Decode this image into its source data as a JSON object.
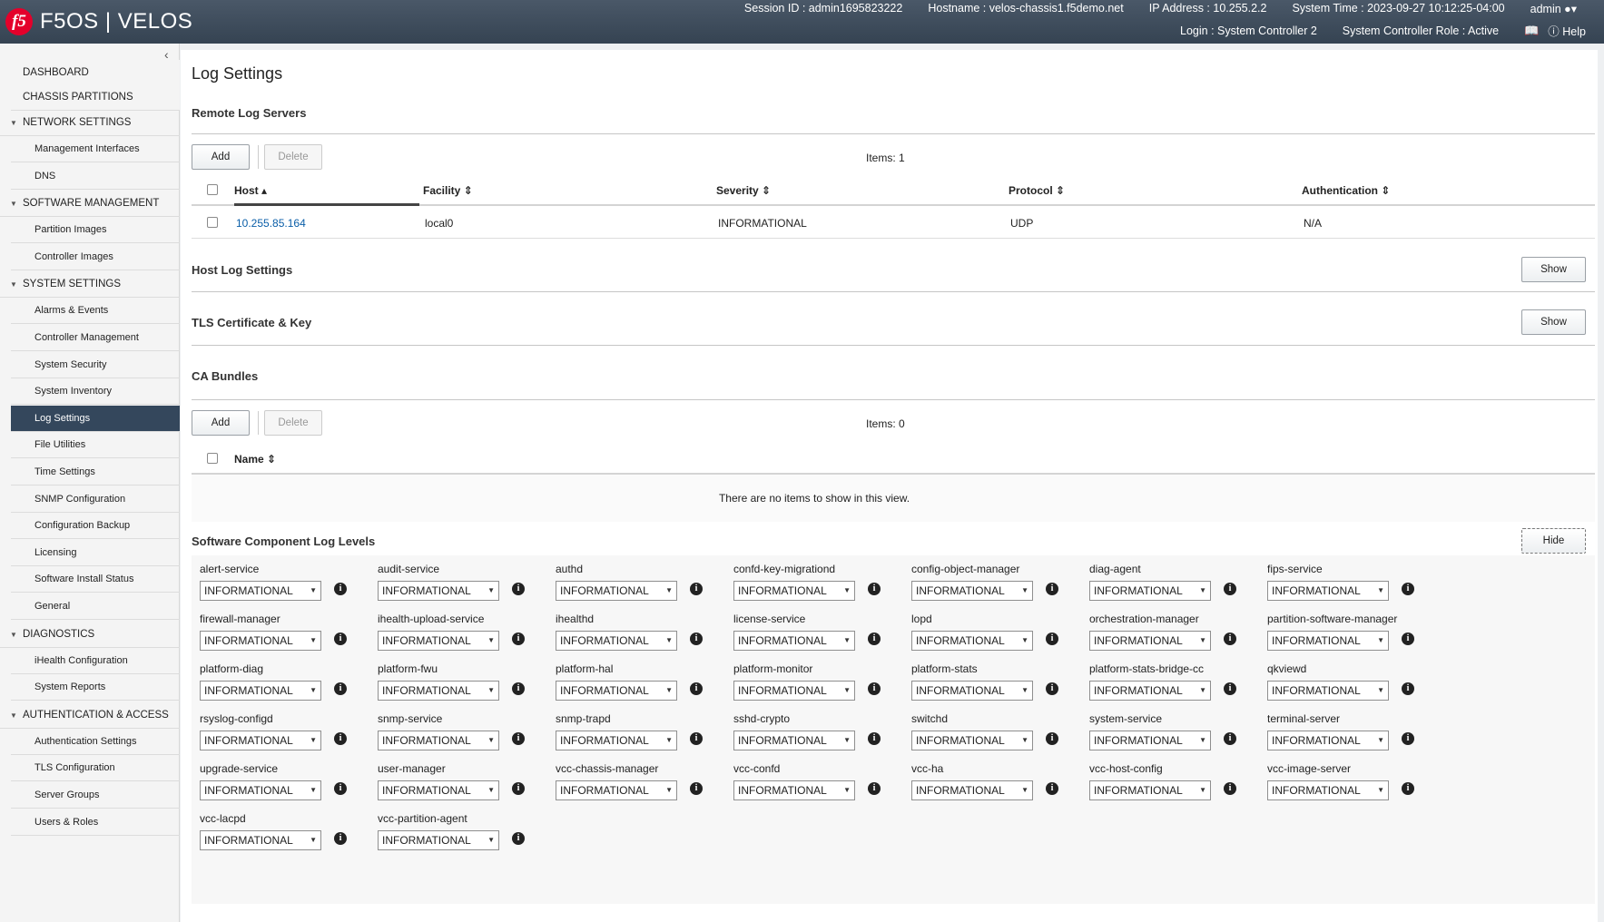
{
  "header": {
    "brand": "F5OS | VELOS",
    "logo": "f5",
    "session": "Session ID : admin1695823222",
    "hostname": "Hostname : velos-chassis1.f5demo.net",
    "ip": "IP Address : 10.255.2.2",
    "time": "System Time : 2023-09-27 10:12:25-04:00",
    "user": "admin",
    "login": "Login : System Controller 2",
    "role": "System Controller Role : Active",
    "help": "Help"
  },
  "sidebar": {
    "top": [
      "DASHBOARD",
      "CHASSIS PARTITIONS"
    ],
    "sections": [
      {
        "label": "NETWORK SETTINGS",
        "items": [
          "Management Interfaces",
          "DNS"
        ]
      },
      {
        "label": "SOFTWARE MANAGEMENT",
        "items": [
          "Partition Images",
          "Controller Images"
        ]
      },
      {
        "label": "SYSTEM SETTINGS",
        "items": [
          "Alarms & Events",
          "Controller Management",
          "System Security",
          "System Inventory",
          "Log Settings",
          "File Utilities",
          "Time Settings",
          "SNMP Configuration",
          "Configuration Backup",
          "Licensing",
          "Software Install Status",
          "General"
        ]
      },
      {
        "label": "DIAGNOSTICS",
        "items": [
          "iHealth Configuration",
          "System Reports"
        ]
      },
      {
        "label": "AUTHENTICATION & ACCESS",
        "items": [
          "Authentication Settings",
          "TLS Configuration",
          "Server Groups",
          "Users & Roles"
        ]
      }
    ],
    "active": "Log Settings"
  },
  "page": {
    "title": "Log Settings",
    "remote": {
      "title": "Remote Log Servers",
      "add": "Add",
      "delete": "Delete",
      "items": "Items: 1",
      "columns": [
        "Host",
        "Facility",
        "Severity",
        "Protocol",
        "Authentication"
      ],
      "rows": [
        {
          "host": "10.255.85.164",
          "facility": "local0",
          "severity": "INFORMATIONAL",
          "protocol": "UDP",
          "auth": "N/A"
        }
      ]
    },
    "host_log": {
      "title": "Host Log Settings",
      "button": "Show"
    },
    "tls": {
      "title": "TLS Certificate & Key",
      "button": "Show"
    },
    "ca": {
      "title": "CA Bundles",
      "add": "Add",
      "delete": "Delete",
      "items": "Items: 0",
      "column": "Name",
      "empty": "There are no items to show in this view."
    },
    "levels": {
      "title": "Software Component Log Levels",
      "button": "Hide",
      "components": [
        {
          "name": "alert-service",
          "value": "INFORMATIONAL"
        },
        {
          "name": "audit-service",
          "value": "INFORMATIONAL"
        },
        {
          "name": "authd",
          "value": "INFORMATIONAL"
        },
        {
          "name": "confd-key-migrationd",
          "value": "INFORMATIONAL"
        },
        {
          "name": "config-object-manager",
          "value": "INFORMATIONAL"
        },
        {
          "name": "diag-agent",
          "value": "INFORMATIONAL"
        },
        {
          "name": "fips-service",
          "value": "INFORMATIONAL"
        },
        {
          "name": "firewall-manager",
          "value": "INFORMATIONAL"
        },
        {
          "name": "ihealth-upload-service",
          "value": "INFORMATIONAL"
        },
        {
          "name": "ihealthd",
          "value": "INFORMATIONAL"
        },
        {
          "name": "license-service",
          "value": "INFORMATIONAL"
        },
        {
          "name": "lopd",
          "value": "INFORMATIONAL"
        },
        {
          "name": "orchestration-manager",
          "value": "INFORMATIONAL"
        },
        {
          "name": "partition-software-manager",
          "value": "INFORMATIONAL"
        },
        {
          "name": "platform-diag",
          "value": "INFORMATIONAL"
        },
        {
          "name": "platform-fwu",
          "value": "INFORMATIONAL"
        },
        {
          "name": "platform-hal",
          "value": "INFORMATIONAL"
        },
        {
          "name": "platform-monitor",
          "value": "INFORMATIONAL"
        },
        {
          "name": "platform-stats",
          "value": "INFORMATIONAL"
        },
        {
          "name": "platform-stats-bridge-cc",
          "value": "INFORMATIONAL"
        },
        {
          "name": "qkviewd",
          "value": "INFORMATIONAL"
        },
        {
          "name": "rsyslog-configd",
          "value": "INFORMATIONAL"
        },
        {
          "name": "snmp-service",
          "value": "INFORMATIONAL"
        },
        {
          "name": "snmp-trapd",
          "value": "INFORMATIONAL"
        },
        {
          "name": "sshd-crypto",
          "value": "INFORMATIONAL"
        },
        {
          "name": "switchd",
          "value": "INFORMATIONAL"
        },
        {
          "name": "system-service",
          "value": "INFORMATIONAL"
        },
        {
          "name": "terminal-server",
          "value": "INFORMATIONAL"
        },
        {
          "name": "upgrade-service",
          "value": "INFORMATIONAL"
        },
        {
          "name": "user-manager",
          "value": "INFORMATIONAL"
        },
        {
          "name": "vcc-chassis-manager",
          "value": "INFORMATIONAL"
        },
        {
          "name": "vcc-confd",
          "value": "INFORMATIONAL"
        },
        {
          "name": "vcc-ha",
          "value": "INFORMATIONAL"
        },
        {
          "name": "vcc-host-config",
          "value": "INFORMATIONAL"
        },
        {
          "name": "vcc-image-server",
          "value": "INFORMATIONAL"
        },
        {
          "name": "vcc-lacpd",
          "value": "INFORMATIONAL"
        },
        {
          "name": "vcc-partition-agent",
          "value": "INFORMATIONAL"
        }
      ]
    }
  },
  "icons": {
    "logo": "f5-logo",
    "user": "user-icon",
    "book": "book-icon",
    "help": "help-circle-icon",
    "info": "info-icon",
    "collapse": "chevron-left-icon"
  },
  "colors": {
    "header": "#3f4d5d",
    "active_nav": "#34475c",
    "link": "#0a5ea8",
    "logo_red": "#e4002b"
  }
}
